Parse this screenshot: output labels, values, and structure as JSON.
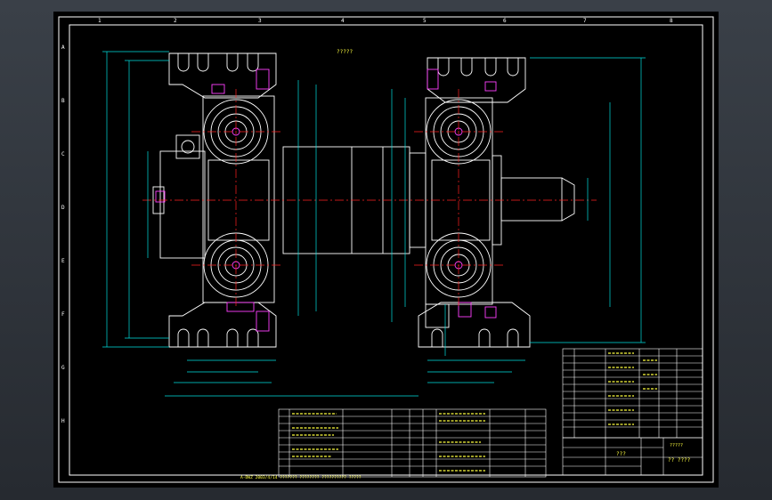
{
  "drawing": {
    "center_label": "?????",
    "title_block": {
      "drawing_name": "???",
      "code": "?? ????",
      "scale_hint": "?????"
    },
    "border_numbers": [
      "1",
      "2",
      "3",
      "4",
      "5",
      "6",
      "7",
      "8"
    ],
    "border_letters": [
      "A",
      "B",
      "C",
      "D",
      "E",
      "F",
      "G",
      "H"
    ],
    "footer_note": "A-DWZ 2003/4/14 ??????? ???????? ?????????? ?????"
  },
  "colors": {
    "background": "#000000",
    "frame_line": "#ffffff",
    "geometry": "#ffffff",
    "centerline": "#ff2020",
    "dimension": "#00e0e0",
    "detail": "#ff40ff",
    "table_text": "#ffff40",
    "table_line": "#ffffff"
  }
}
